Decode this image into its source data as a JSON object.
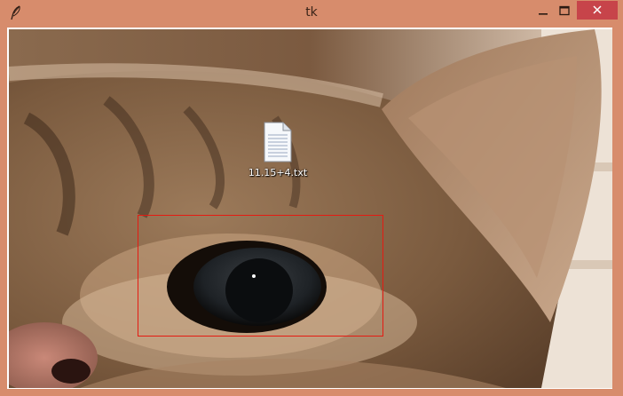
{
  "window": {
    "title": "tk",
    "app_icon": "feather-icon",
    "controls": {
      "minimize_icon": "minimize-icon",
      "maximize_icon": "maximize-icon",
      "close_icon": "close-icon"
    }
  },
  "desktop_file": {
    "icon": "text-file-icon",
    "label": "11.15+4.txt"
  },
  "colors": {
    "titlebar": "#d78c6c",
    "close_button": "#c7444a",
    "selection_border": "#e41b12"
  }
}
